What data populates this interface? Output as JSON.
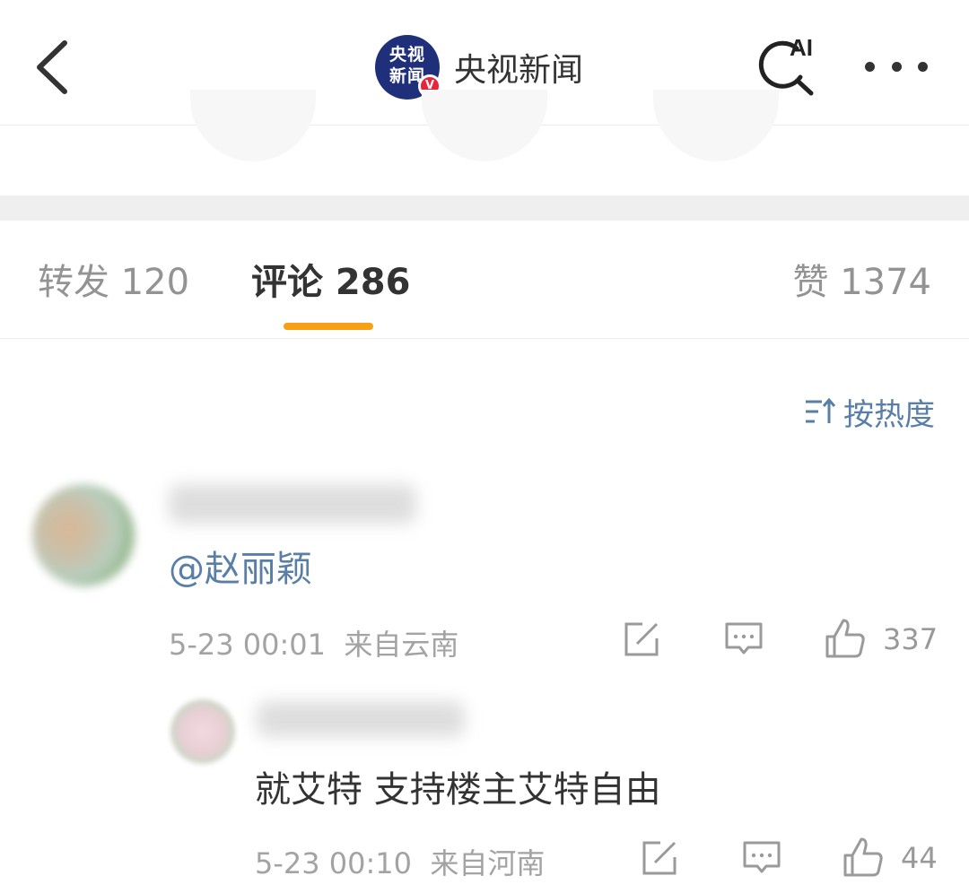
{
  "header": {
    "account_name": "央视新闻",
    "logo_text": "央视新闻",
    "verified_badge": "V",
    "ai_label": "AI"
  },
  "tabs": [
    {
      "label": "转发 120",
      "active": false
    },
    {
      "label": "评论 286",
      "active": true
    },
    {
      "label": "赞 1374",
      "active": false
    }
  ],
  "sort": {
    "label": "按热度",
    "icon": "sort-icon"
  },
  "comments": [
    {
      "text": "@赵丽颖",
      "time": "5-23 00:01",
      "location": "来自云南",
      "likes": "337",
      "replies": [
        {
          "text": "就艾特 支持楼主艾特自由",
          "time": "5-23 00:10",
          "location": "来自河南",
          "likes": "44"
        }
      ]
    }
  ],
  "colors": {
    "accent": "#f7a013",
    "link": "#5a7fa6",
    "muted": "#a3a3a3",
    "text": "#333333"
  }
}
